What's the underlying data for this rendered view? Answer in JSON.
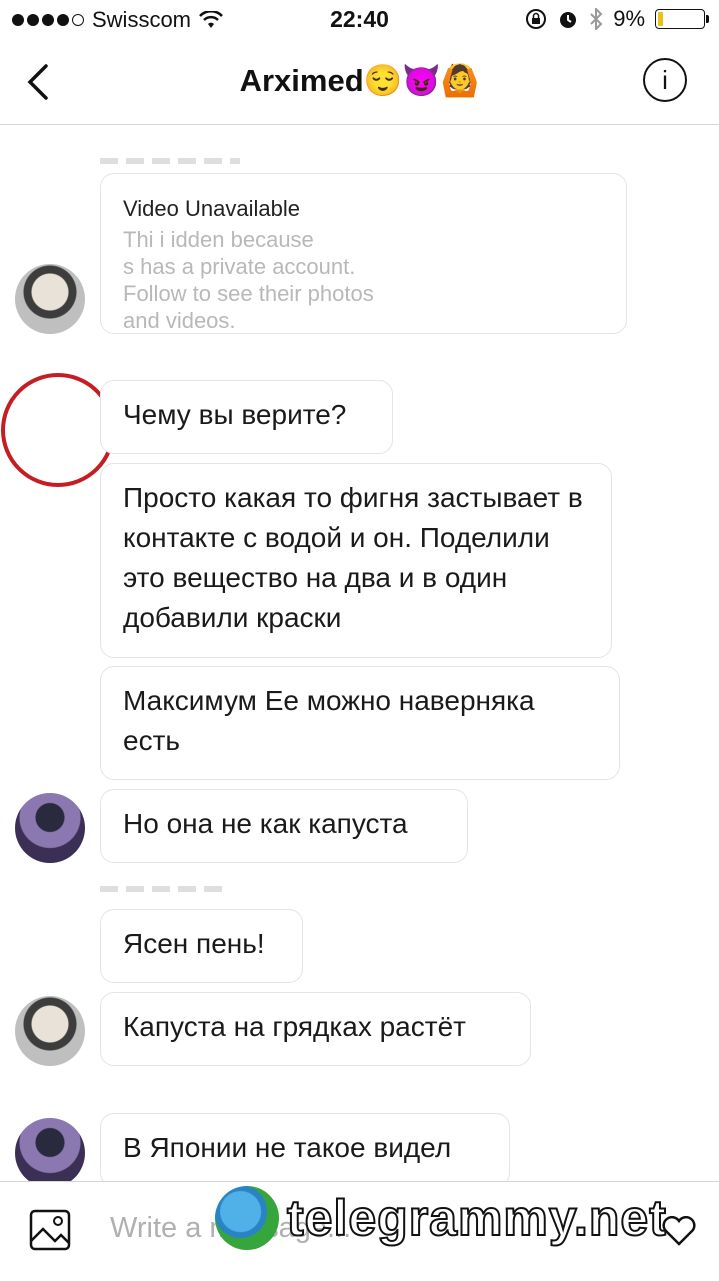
{
  "status_bar": {
    "carrier": "Swisscom",
    "time": "22:40",
    "battery": "9%"
  },
  "header": {
    "title": "Arximed😌😈🙆"
  },
  "video_card": {
    "title": "Video Unavailable",
    "line1": "Thi        i     idden because",
    "line2": "              s has a private account.",
    "line3": "Follow                    to see their photos",
    "line4": "and videos."
  },
  "messages": [
    "Чему вы верите?",
    "Просто какая то фигня застывает в контакте с водой и он. Поделили это вещество на два и в один добавили краски",
    "Максимум Ее можно наверняка есть",
    "Но она не как капуста",
    "Ясен пень!",
    "Капуста на грядках растёт",
    "В Японии не такое видел"
  ],
  "composer": {
    "placeholder": "Write a message..."
  },
  "watermark": "telegrammy.net"
}
